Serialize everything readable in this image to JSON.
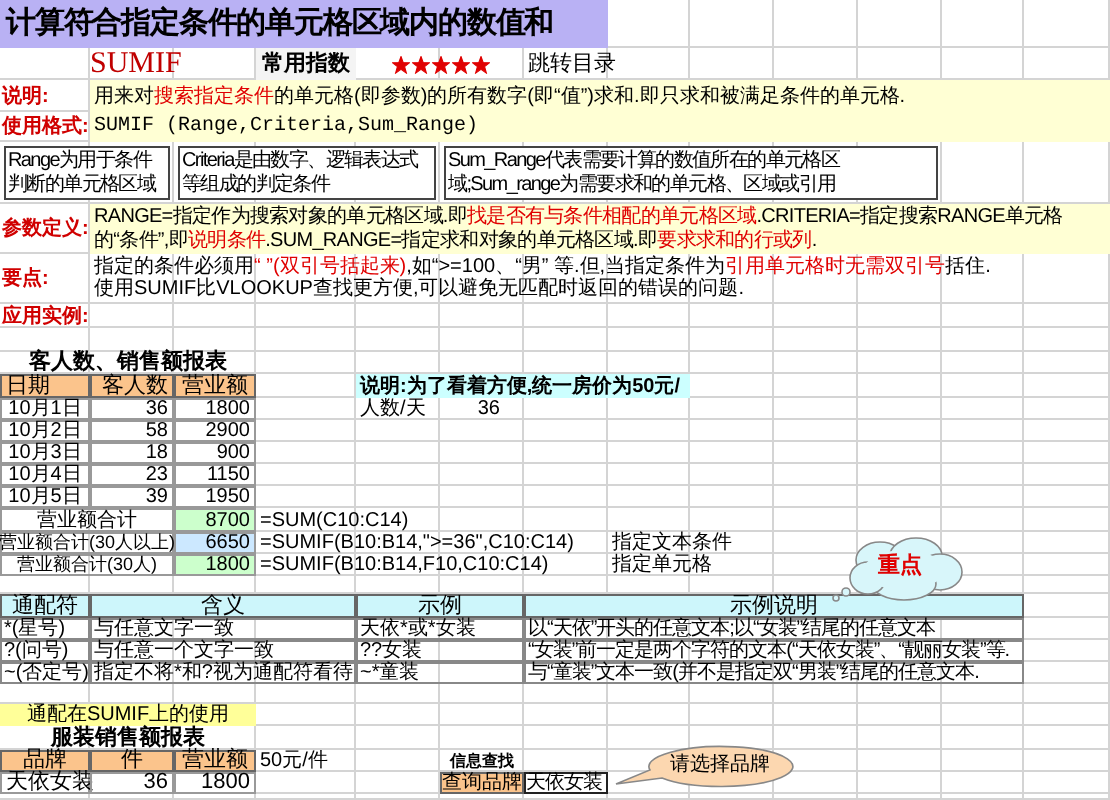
{
  "title": "计算符合指定条件的单元格区域内的数值和",
  "function_row": {
    "name": "SUMIF",
    "rating_label": "常用指数",
    "stars": 5,
    "link": "跳转目录"
  },
  "description": {
    "label": "说明:",
    "parts": [
      {
        "text": "用来对",
        "highlight": false
      },
      {
        "text": "搜索指定条件",
        "highlight": true
      },
      {
        "text": "的单元格(即参数)的所有数字(即“值”)求和.即只求和被满足条件的单元格.",
        "highlight": false
      }
    ]
  },
  "syntax": {
    "label": "使用格式:",
    "formula": "SUMIF (Range,Criteria,Sum_Range)",
    "notes": [
      "Range为用于条件判断的单元格区域",
      "Criteria是由数字、逻辑表达式等组成的判定条件",
      "Sum_Range代表需要计算的数值所在的单元格区域;Sum_range为需要求和的单元格、区域或引用"
    ]
  },
  "parameters": {
    "label": "参数定义:",
    "parts": [
      {
        "text": "RANGE=指定作为搜索对象的单元格区域.即",
        "highlight": false
      },
      {
        "text": "找是否有与条件相配的单元格区域",
        "highlight": true
      },
      {
        "text": ".CRITERIA=指定搜索RANGE单元格的“条件”,即",
        "highlight": false
      },
      {
        "text": "说明条件",
        "highlight": true
      },
      {
        "text": ".SUM_RANGE=指定求和对象的单元格区域.即",
        "highlight": false
      },
      {
        "text": "要求求和的行或列",
        "highlight": true
      },
      {
        "text": ".",
        "highlight": false
      }
    ]
  },
  "key_points": {
    "label": "要点:",
    "lines": [
      [
        {
          "text": "指定的条件必须用",
          "highlight": false
        },
        {
          "text": "“ ”(双引号括起来)",
          "highlight": true
        },
        {
          "text": ",如“>=100、“男” 等.但,当指定条件为",
          "highlight": false
        },
        {
          "text": "引用单元格时无需双引号",
          "highlight": true
        },
        {
          "text": "括住.",
          "highlight": false
        }
      ],
      [
        {
          "text": "使用SUMIF比VLOOKUP查找更方便,可以避免无匹配时返回的错误的问题.",
          "highlight": false
        }
      ]
    ]
  },
  "example_label": "应用实例:",
  "sales_table": {
    "title": "客人数、销售额报表",
    "columns": [
      "日期",
      "客人数",
      "营业额"
    ],
    "rows": [
      [
        "10月1日",
        "36",
        "1800"
      ],
      [
        "10月2日",
        "58",
        "2900"
      ],
      [
        "10月3日",
        "18",
        "900"
      ],
      [
        "10月4日",
        "23",
        "1150"
      ],
      [
        "10月5日",
        "39",
        "1950"
      ]
    ],
    "totals": [
      {
        "label": "营业额合计",
        "value": "8700",
        "color": "#ccffcc",
        "formula": "=SUM(C10:C14)"
      },
      {
        "label": "营业额合计(30人以上)",
        "value": "6650",
        "color": "#cce8ff",
        "formula": "=SUMIF(B10:B14,\">=36\",C10:C14)",
        "note": "指定文本条件"
      },
      {
        "label": "营业额合计(30人)",
        "value": "1800",
        "color": "#ccffcc",
        "formula": "=SUMIF(B10:B14,F10,C10:C14)",
        "note": "指定单元格"
      }
    ]
  },
  "price_note": {
    "text": "说明:为了看着方便,统一房价为50元/",
    "label": "人数/天",
    "value": "36"
  },
  "key_callout": "重点",
  "wildcards": {
    "columns": [
      "通配符",
      "含义",
      "示例",
      "示例说明"
    ],
    "rows": [
      [
        "*(星号)",
        "与任意文字一致",
        "天依*或*女装",
        "以“天依”开头的任意文本;以“女装”结尾的任意文本"
      ],
      [
        "?(问号)",
        "与任意一个文字一致",
        "??女装",
        "“女装”前一定是两个字符的文本(“天依女装”、“靓丽女装”等."
      ],
      [
        "~(否定号)",
        "指定不将*和?视为通配符看待",
        "~*童装",
        "与“童装”文本一致(并不是指定双“男装”结尾的任意文本."
      ]
    ]
  },
  "wildcard_usage": "通配在SUMIF上的使用",
  "clothing_table": {
    "title": "服装销售额报表",
    "columns": [
      "品牌",
      "件",
      "营业额"
    ],
    "unit_price": "50元/件",
    "rows": [
      [
        "天依女装",
        "36",
        "1800"
      ]
    ]
  },
  "lookup": {
    "title": "信息查找",
    "label": "查询品牌",
    "value": "天依女装"
  },
  "brand_callout": "请选择品牌"
}
